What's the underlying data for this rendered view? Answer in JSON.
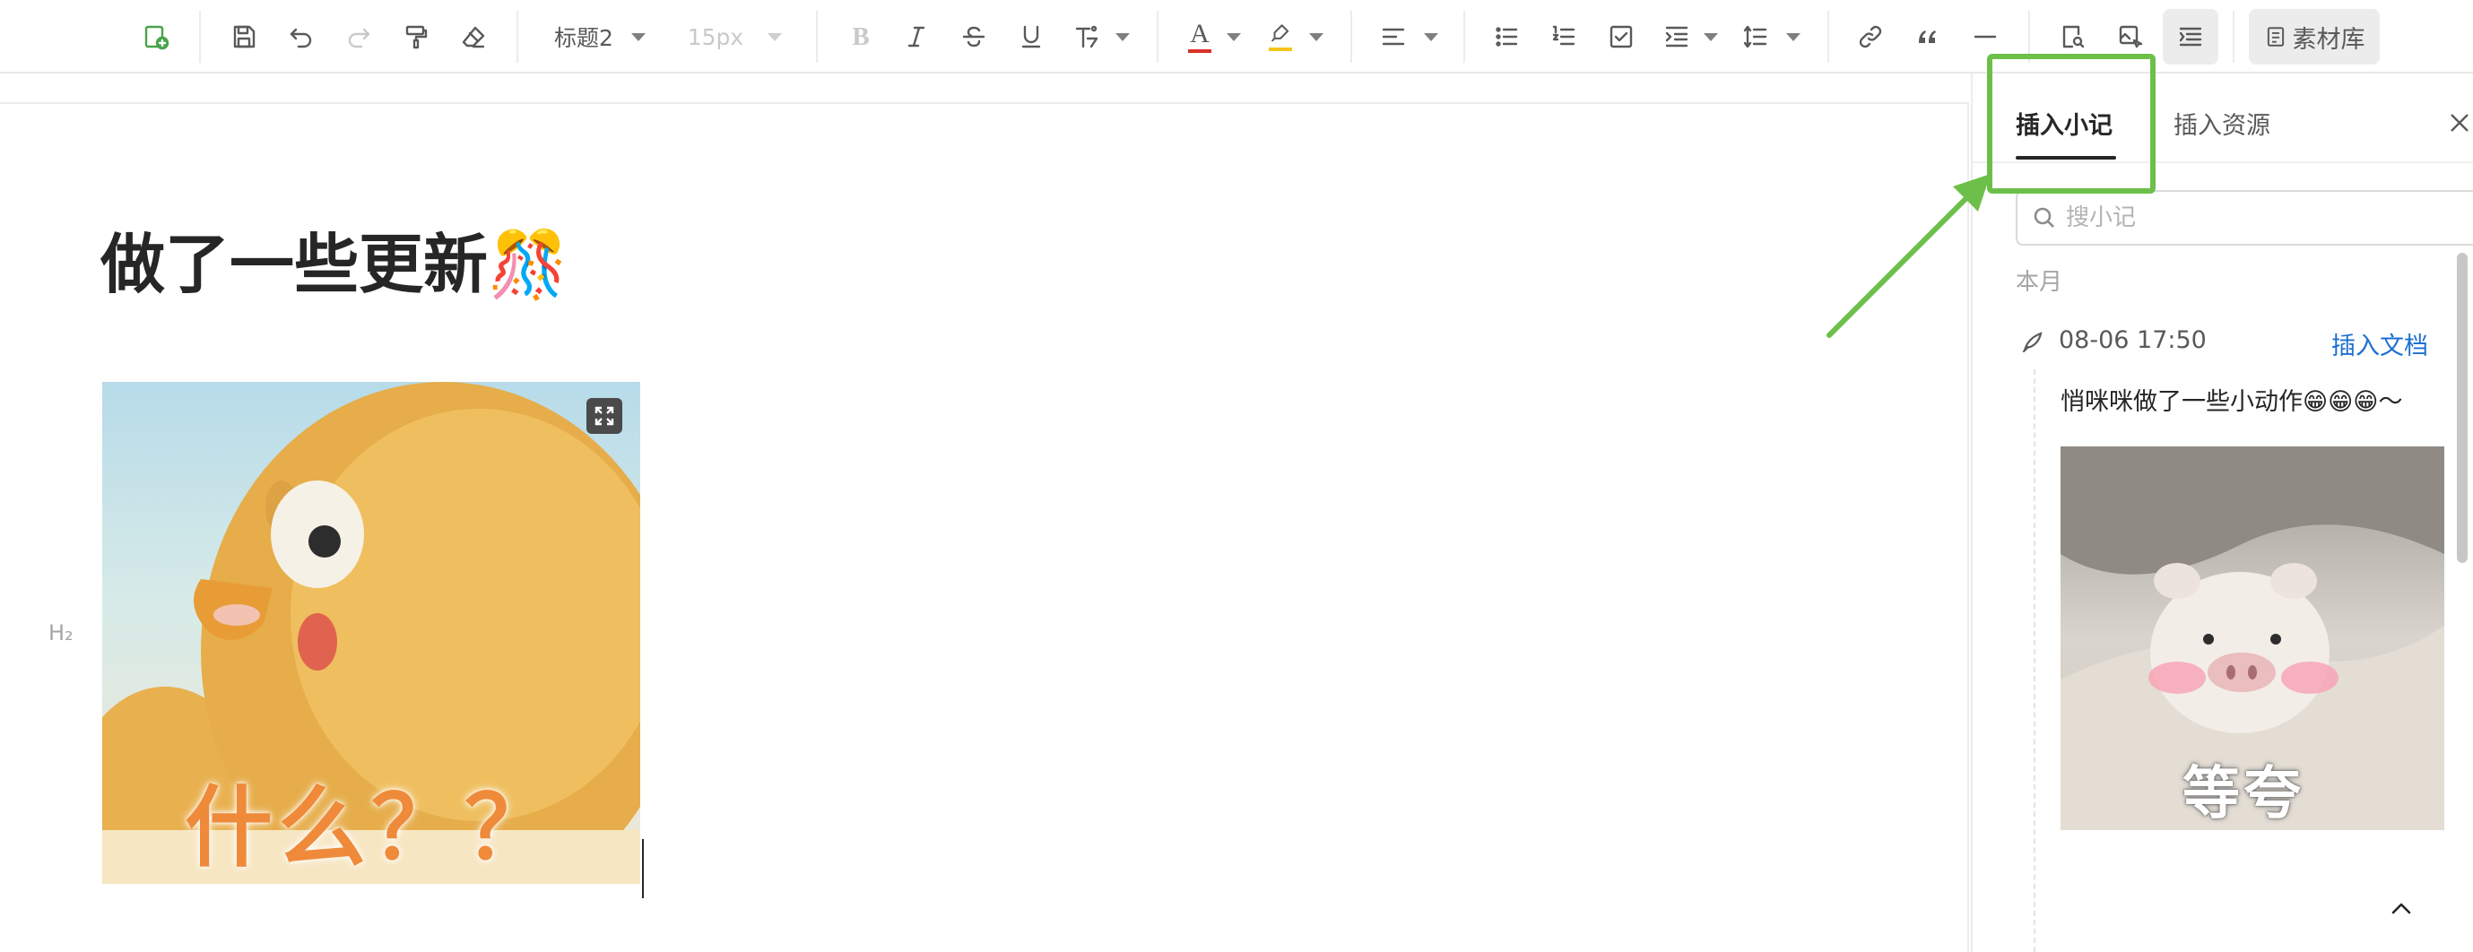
{
  "toolbar": {
    "heading_select": "标题2",
    "font_size_select": "15px",
    "bold_label": "B",
    "text_color_label": "A",
    "materials_button": "素材库",
    "accent_text_color": "#d93026",
    "accent_highlight_color": "#f5c518"
  },
  "editor": {
    "title": "做了一些更新🎊",
    "block_marker": "H₂",
    "image_caption": "什么？？"
  },
  "panel": {
    "tab_notes": "插入小记",
    "tab_resources": "插入资源",
    "search_placeholder": "搜小记",
    "section_label": "本月",
    "note": {
      "time": "08-06 17:50",
      "insert_link": "插入文档",
      "text": "悄咪咪做了一些小动作😁😁😁～",
      "image_caption": "等夸"
    }
  },
  "colors": {
    "annotation_green": "#6cc04a",
    "link_blue": "#1d6fd1"
  }
}
